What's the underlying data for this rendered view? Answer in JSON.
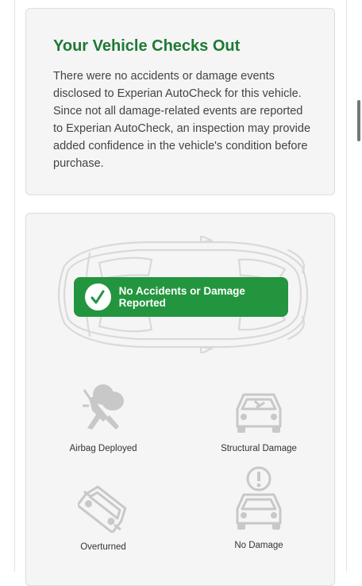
{
  "summary": {
    "title": "Your Vehicle Checks Out",
    "body": "There were no accidents or damage events disclosed to Experian AutoCheck for this vehicle. Since not all damage-related events are reported to Experian AutoCheck, an inspection may provide added confidence in the vehicle's condition before purchase."
  },
  "status": {
    "label": "No Accidents or Damage Reported",
    "icon": "checkmark-icon",
    "color": "#23953e"
  },
  "categories": [
    {
      "label": "Airbag Deployed",
      "icon": "airbag-icon"
    },
    {
      "label": "Structural Damage",
      "icon": "structural-damage-icon"
    },
    {
      "label": "Overturned",
      "icon": "overturned-icon"
    },
    {
      "label": "No Damage",
      "icon": "no-damage-icon"
    }
  ],
  "colors": {
    "title_green": "#1e7a34",
    "icon_gray": "#c8c8c8",
    "card_bg": "#f5f5f5"
  }
}
